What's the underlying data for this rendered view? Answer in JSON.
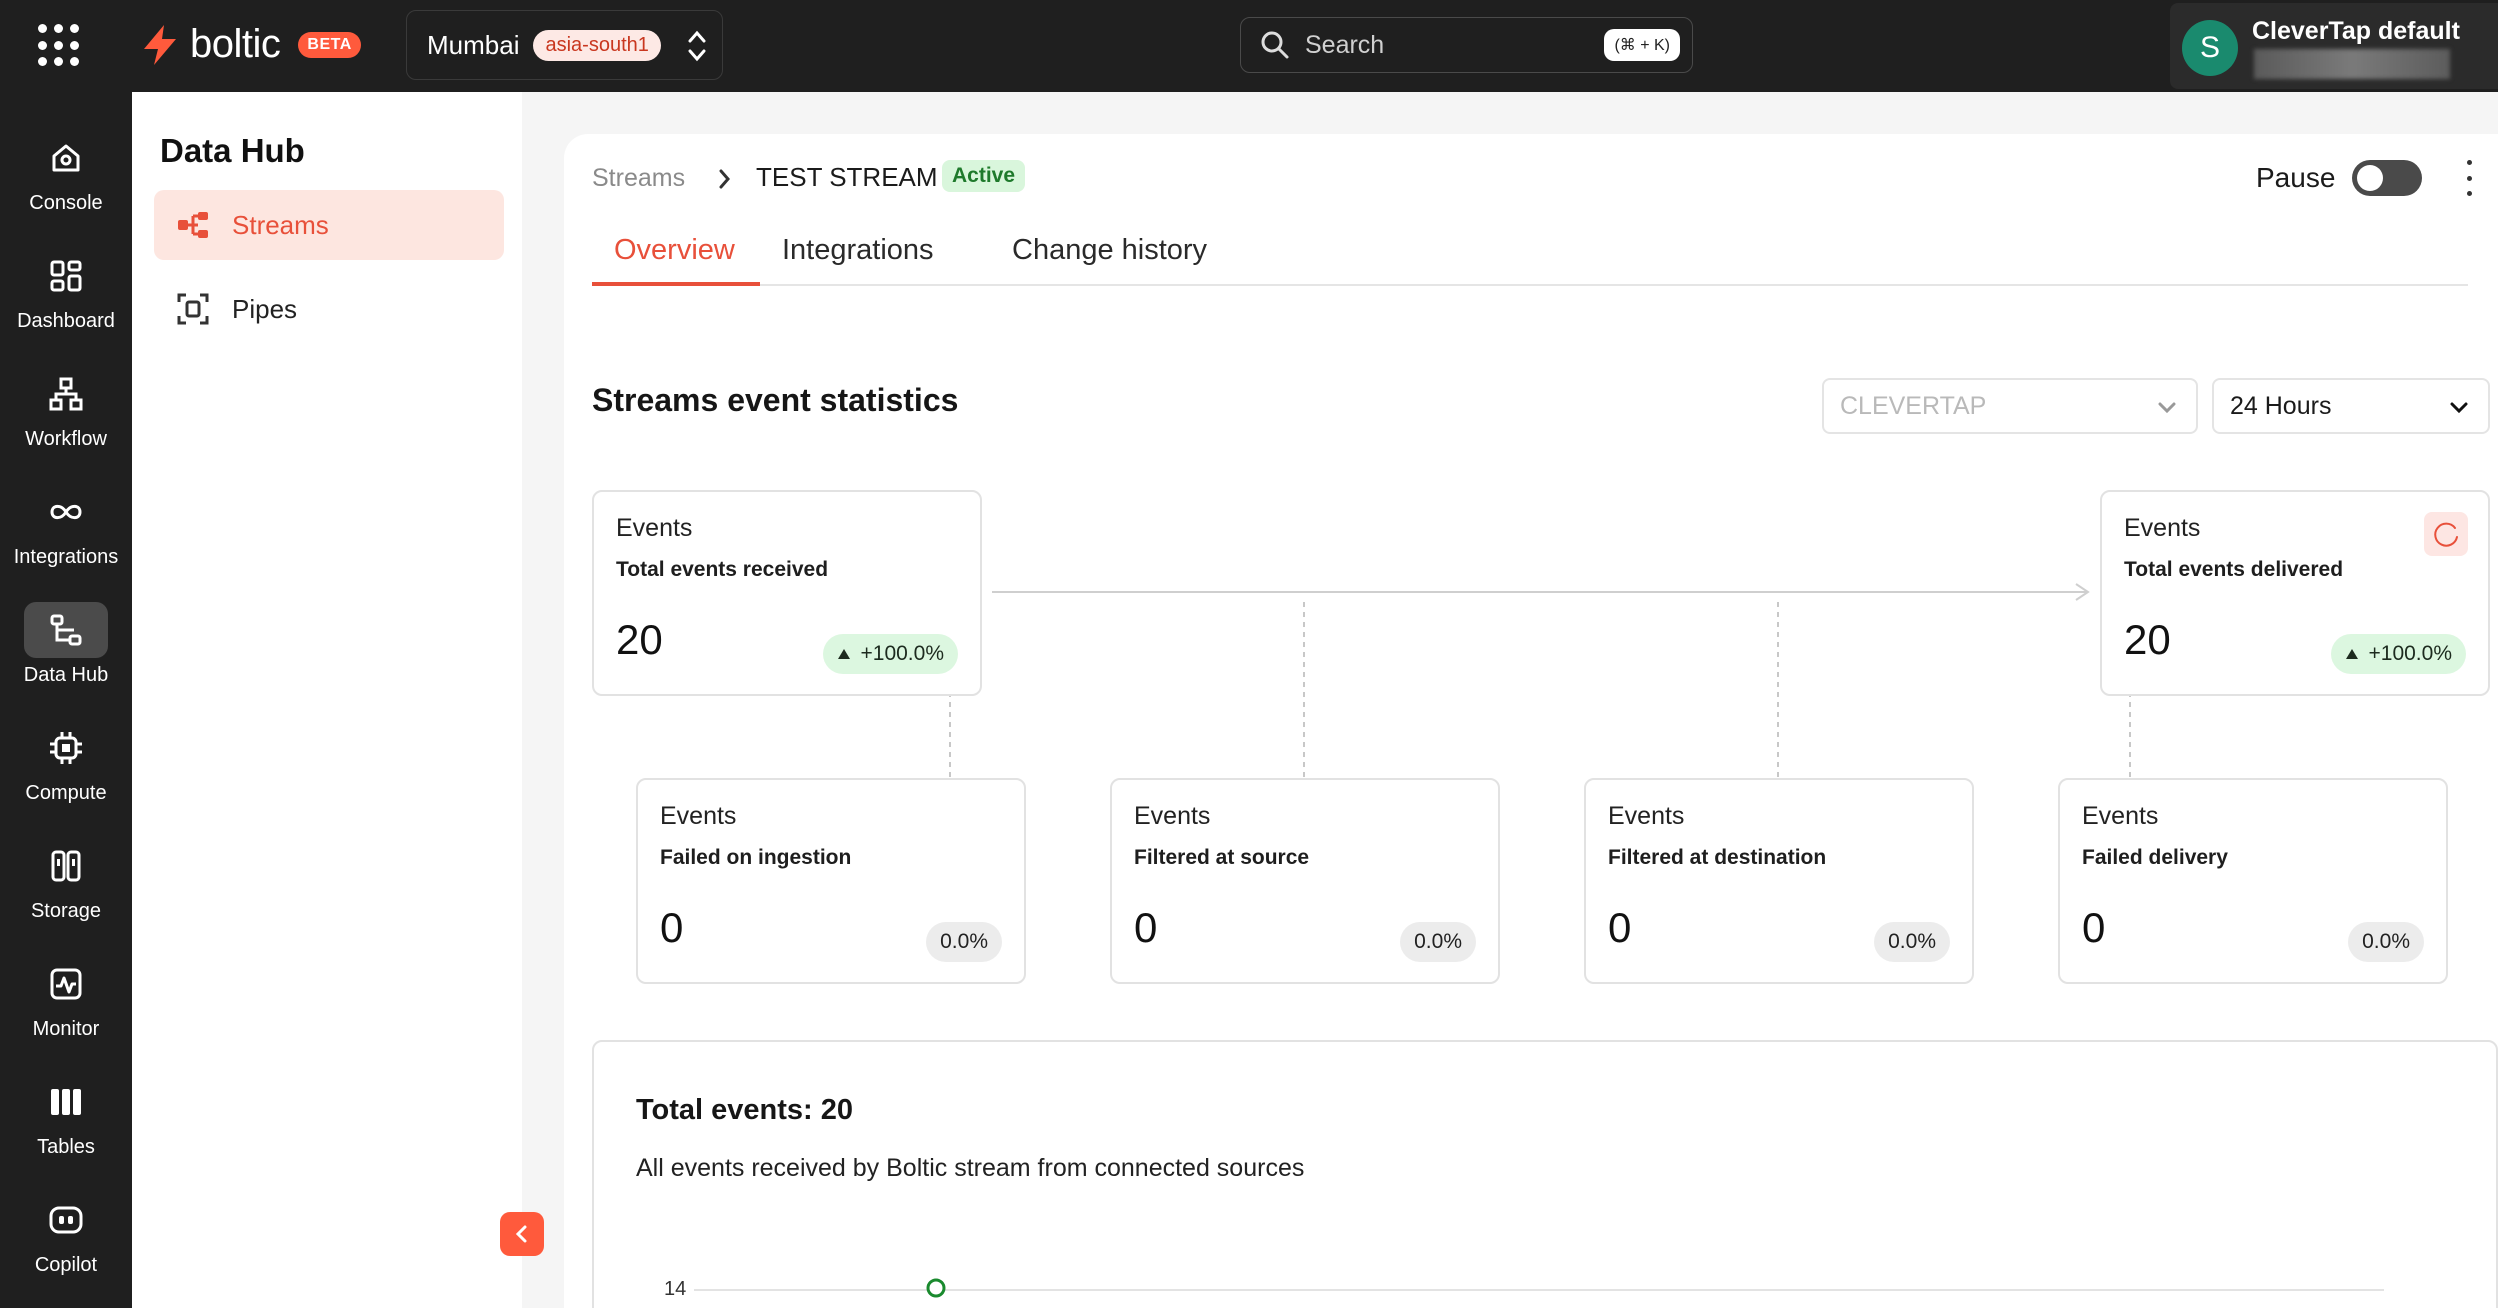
{
  "topbar": {
    "brand": "boltic",
    "beta": "BETA",
    "region_city": "Mumbai",
    "region_code": "asia-south1",
    "search_placeholder": "Search",
    "search_shortcut": "(⌘ + K)",
    "account_initial": "S",
    "account_name": "CleverTap default"
  },
  "leftnav": [
    {
      "label": "Console",
      "icon": "home-icon"
    },
    {
      "label": "Dashboard",
      "icon": "dashboard-icon"
    },
    {
      "label": "Workflow",
      "icon": "workflow-icon"
    },
    {
      "label": "Integrations",
      "icon": "integrations-icon"
    },
    {
      "label": "Data Hub",
      "icon": "data-hub-icon",
      "active": true
    },
    {
      "label": "Compute",
      "icon": "compute-icon"
    },
    {
      "label": "Storage",
      "icon": "storage-icon"
    },
    {
      "label": "Monitor",
      "icon": "monitor-icon"
    },
    {
      "label": "Tables",
      "icon": "tables-icon"
    },
    {
      "label": "Copilot",
      "icon": "copilot-icon"
    }
  ],
  "hub": {
    "title": "Data Hub",
    "items": [
      {
        "label": "Streams",
        "icon": "streams-icon",
        "active": true
      },
      {
        "label": "Pipes",
        "icon": "pipes-icon"
      }
    ]
  },
  "main": {
    "breadcrumb_root": "Streams",
    "stream_name": "TEST STREAM",
    "status": "Active",
    "pause_label": "Pause",
    "pause_on": false,
    "tabs": [
      "Overview",
      "Integrations",
      "Change history"
    ],
    "active_tab": "Overview",
    "section_title": "Streams event statistics",
    "source_select": "CLEVERTAP",
    "range_select": "24 Hours",
    "cards": [
      {
        "title": "Events",
        "subtitle": "Total events received",
        "value": "20",
        "change": "+100.0%",
        "trend": "up"
      },
      {
        "title": "Events",
        "subtitle": "Total events delivered",
        "value": "20",
        "change": "+100.0%",
        "trend": "up"
      },
      {
        "title": "Events",
        "subtitle": "Failed on ingestion",
        "value": "0",
        "change": "0.0%",
        "trend": "flat"
      },
      {
        "title": "Events",
        "subtitle": "Filtered at source",
        "value": "0",
        "change": "0.0%",
        "trend": "flat"
      },
      {
        "title": "Events",
        "subtitle": "Filtered at destination",
        "value": "0",
        "change": "0.0%",
        "trend": "flat"
      },
      {
        "title": "Events",
        "subtitle": "Failed delivery",
        "value": "0",
        "change": "0.0%",
        "trend": "flat"
      }
    ],
    "totals": {
      "title": "Total events: 20",
      "description": "All events received by Boltic stream from connected sources",
      "y_tick_top": "14"
    }
  },
  "colors": {
    "accent": "#ff5a3c",
    "topbar": "#1f1f1f",
    "active_green": "#1f7a2c"
  }
}
